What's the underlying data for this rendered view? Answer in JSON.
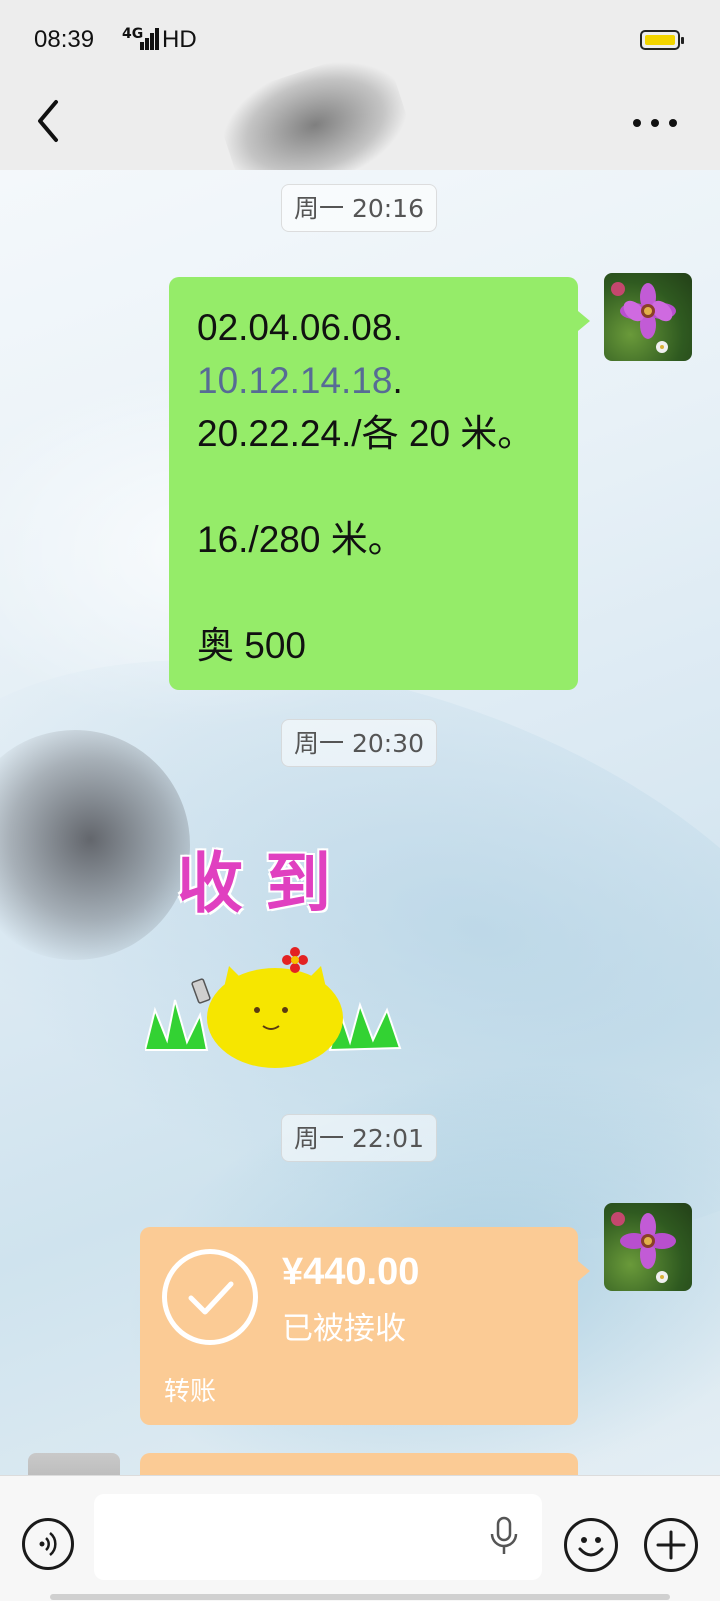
{
  "status_bar": {
    "time": "08:39",
    "network": "4G",
    "signal_label": "HD"
  },
  "nav": {
    "back_icon": "chevron-left-icon",
    "more_icon": "more-dots-icon"
  },
  "messages": {
    "ts1": "周一 20:16",
    "text_message": {
      "line1": "02.04.06.08.",
      "line2_link": "10.12.14.18",
      "line2_suffix": ".",
      "line3": "20.22.24./各 20 米。",
      "line4": "16./280 米。",
      "line5": "奥 500"
    },
    "ts2": "周一 20:30",
    "sticker": {
      "text": "收到"
    },
    "ts3": "周一 22:01",
    "transfer": {
      "amount": "¥440.00",
      "status": "已被接收",
      "label": "转账"
    }
  },
  "colors": {
    "text_bubble": "#95ec69",
    "transfer_bubble": "#fbcb95",
    "link": "#576b95",
    "sticker_text": "#e040c0"
  },
  "input_bar": {
    "voice_icon": "voice-icon",
    "mic_icon": "microphone-icon",
    "emoji_icon": "emoji-icon",
    "plus_icon": "plus-icon"
  }
}
